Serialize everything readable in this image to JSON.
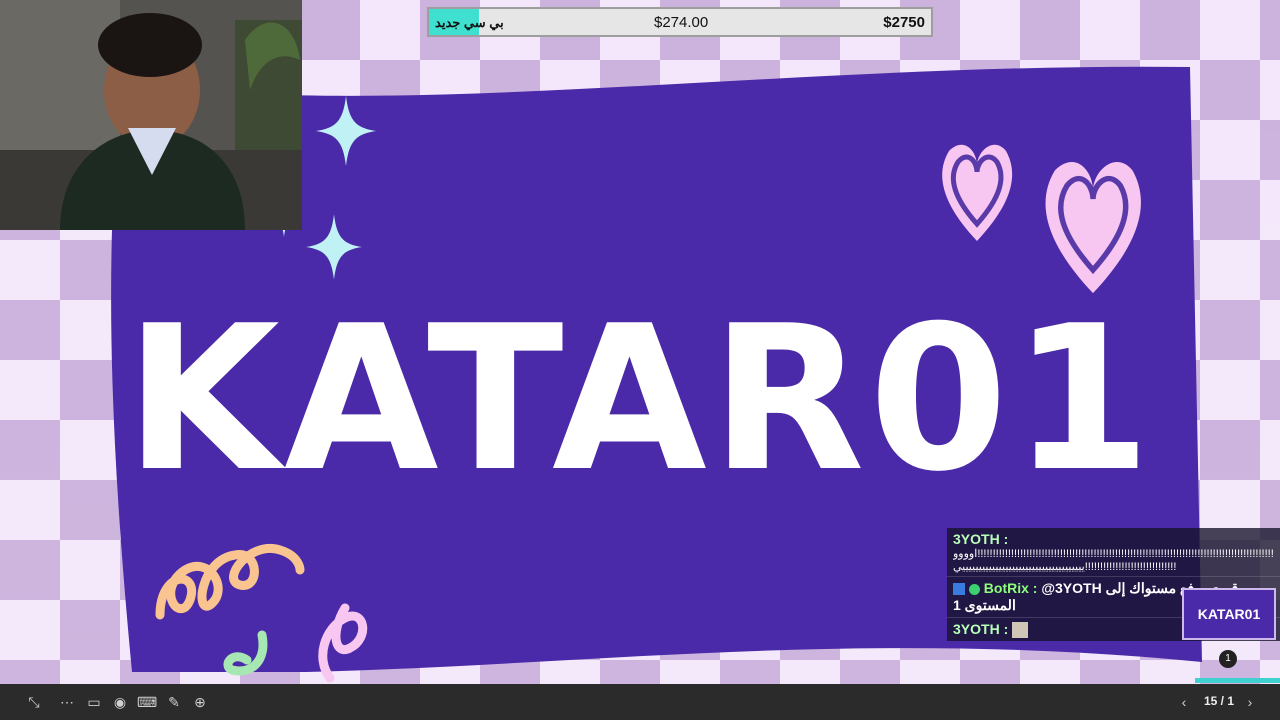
{
  "slide": {
    "title": "KATAR01"
  },
  "goal_bar": {
    "label": "بي سي جديد",
    "current": "$274.00",
    "target": "$2750",
    "progress": 0.1
  },
  "chat": {
    "messages": [
      {
        "user": "3YOTH",
        "separator": ":",
        "text": "اوووو!!!!!!!!!!!!!!!!!!!!!!!!!!!!!!!!!!!!!!!!!!!!!!!!!!!!!!!!!!!!!!!!!!!!!!!!!!!!!!!!!!!!!!!!!!!!!!!!!!!!!!"
      },
      {
        "user": "",
        "separator": "",
        "text": "يييييييييييييييييييييييييييييييييييييي!!!!!!!!!!!!!!!!!!!!!!!!!!!!!!"
      },
      {
        "user": "BotRix",
        "separator": ":",
        "text": "@3YOTH قمت برفع مستواك إلى المستوى 1"
      },
      {
        "user": "3YOTH",
        "separator": ":",
        "text": ""
      }
    ]
  },
  "thumbnail": {
    "label": "KATAR01"
  },
  "page_badge": "1",
  "pager": {
    "text": "15 / 1"
  },
  "colors": {
    "banner": "#4a2aa8",
    "accent": "#3fe0d0",
    "heart": "#f7c6f1",
    "sparkle": "#bff1f5"
  }
}
